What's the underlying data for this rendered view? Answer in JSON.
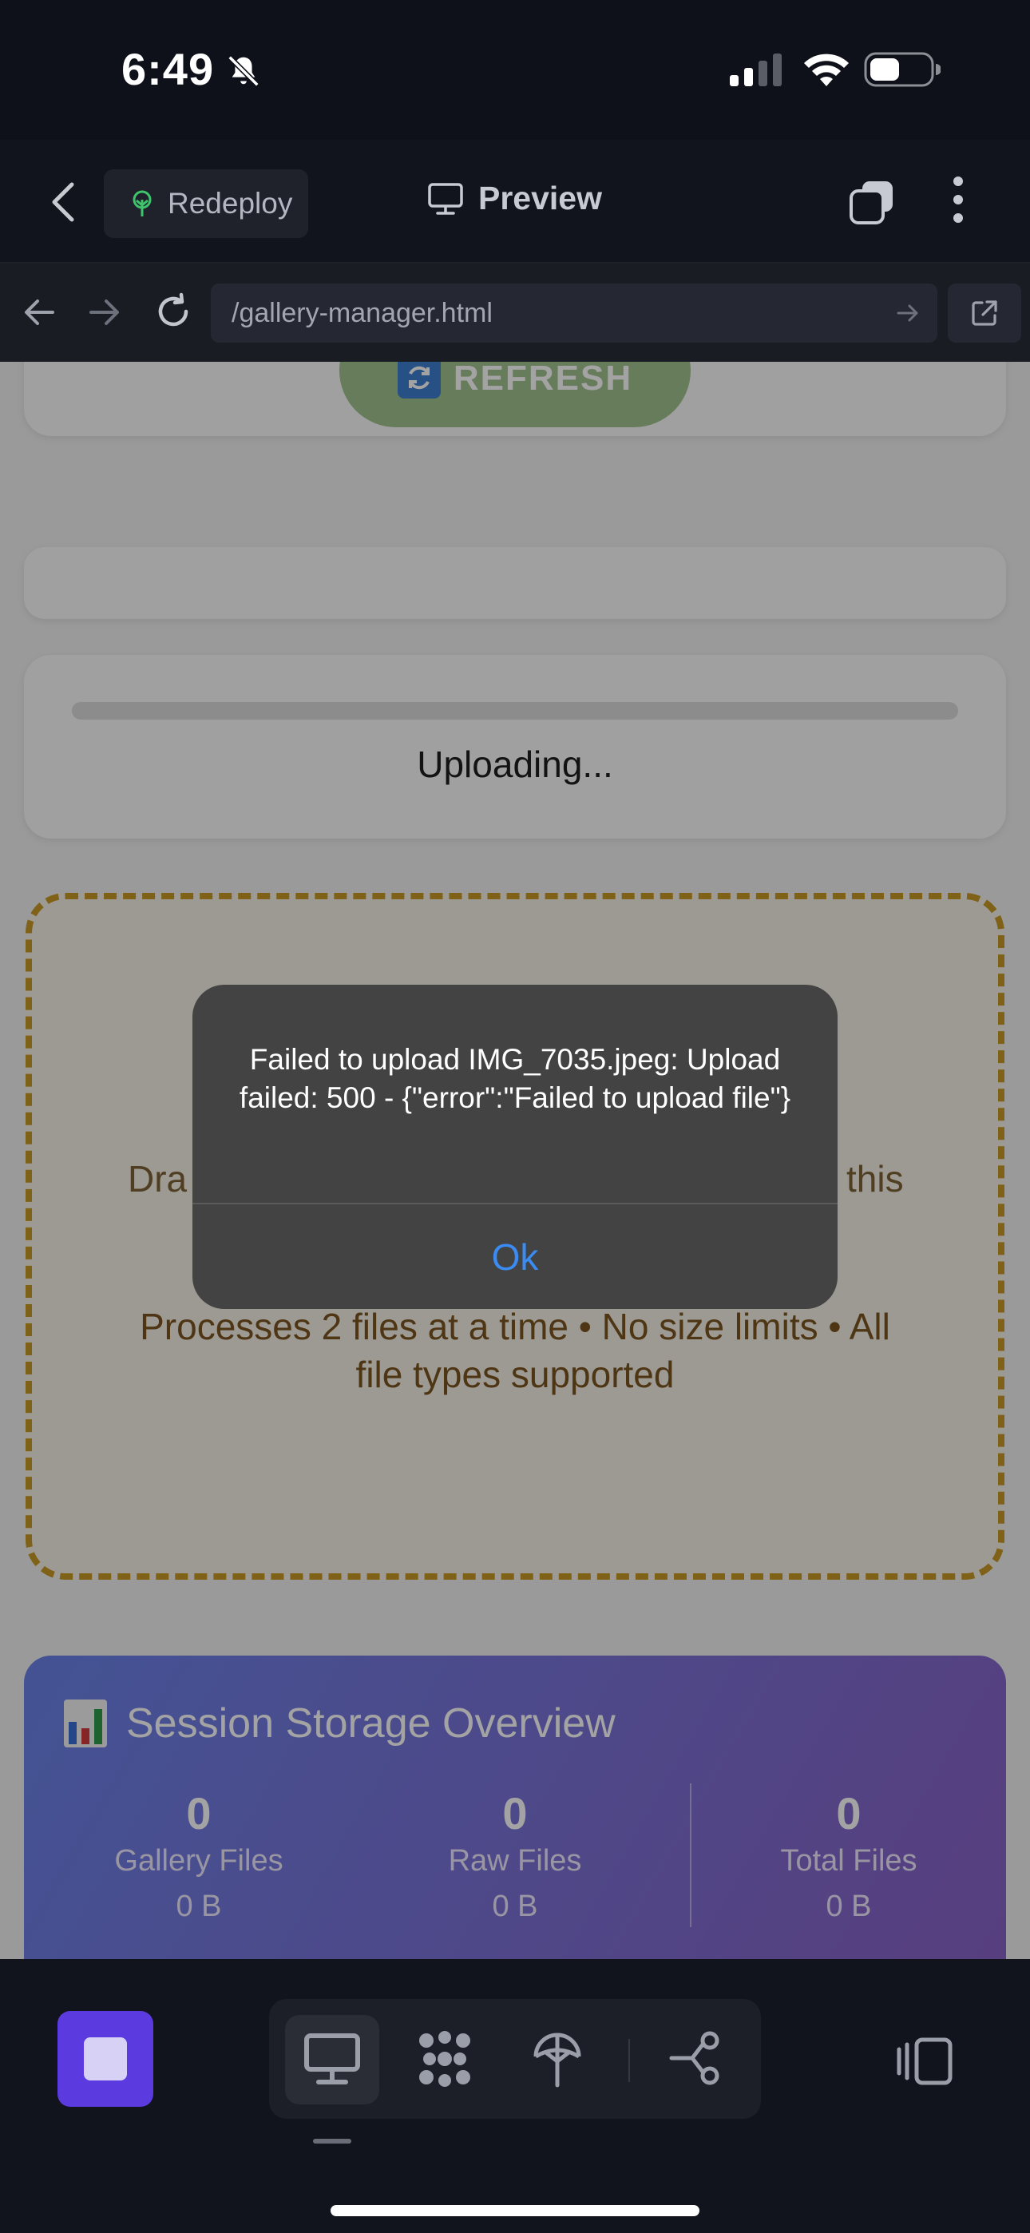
{
  "status_bar": {
    "time": "6:49"
  },
  "header": {
    "redeploy_label": "Redeploy",
    "title": "Preview"
  },
  "url_bar": {
    "url": "/gallery-manager.html"
  },
  "page": {
    "refresh_label": "REFRESH",
    "uploading_text": "Uploading...",
    "drop_text_left": "Dra",
    "drop_text_right": "this",
    "drop_subtext": "Processes 2 files at a time • No size limits • All file types supported",
    "stats": {
      "title": "Session Storage Overview",
      "items": [
        {
          "value": "0",
          "label": "Gallery Files",
          "size": "0 B"
        },
        {
          "value": "0",
          "label": "Raw Files",
          "size": "0 B"
        },
        {
          "value": "0",
          "label": "Total Files",
          "size": "0 B"
        }
      ]
    }
  },
  "alert": {
    "message": "Failed to upload IMG_7035.jpeg: Upload failed: 500 - {\"error\":\"Failed to upload file\"}",
    "ok_label": "Ok"
  },
  "colors": {
    "accent_purple": "#5b3ae0",
    "alert_button_blue": "#3b8cf2",
    "drop_zone_border": "#c79824"
  }
}
